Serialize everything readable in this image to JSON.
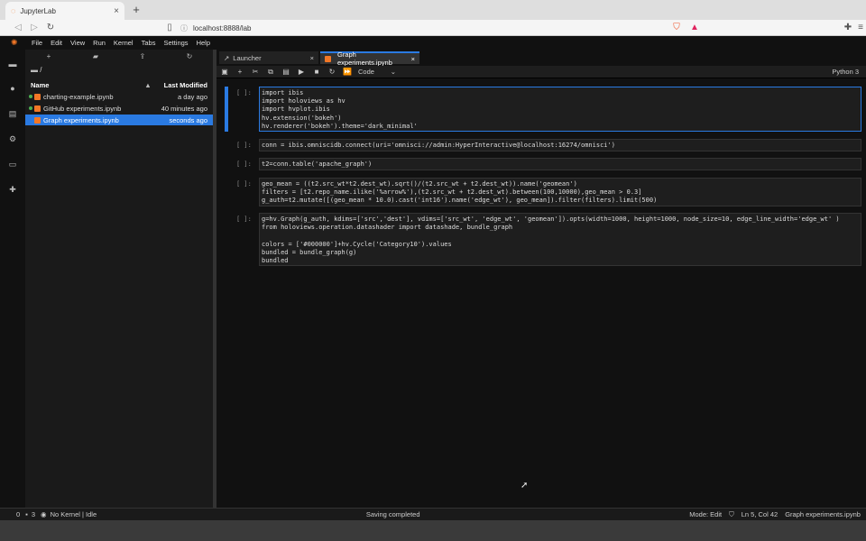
{
  "browser": {
    "tab_title": "JupyterLab",
    "tab_close": "×",
    "new_tab": "+",
    "back": "◁",
    "forward": "▷",
    "reload": "↻",
    "url": "localhost:8888/lab"
  },
  "menubar": {
    "items": [
      "File",
      "Edit",
      "View",
      "Run",
      "Kernel",
      "Tabs",
      "Settings",
      "Help"
    ]
  },
  "filebrowser": {
    "path": "/",
    "col_name": "Name",
    "col_modified": "Last Modified",
    "sort_indicator": "▲",
    "files": [
      {
        "name": "charting-example.ipynb",
        "modified": "a day ago",
        "running": true
      },
      {
        "name": "GitHub experiments.ipynb",
        "modified": "40 minutes ago",
        "running": true
      },
      {
        "name": "Graph experiments.ipynb",
        "modified": "seconds ago",
        "running": false
      }
    ]
  },
  "tabs": [
    {
      "label": "Launcher",
      "close": "×"
    },
    {
      "label": "Graph experiments.ipynb",
      "close": "×"
    }
  ],
  "toolbar": {
    "cell_type": "Code",
    "dropdown": "⌄",
    "kernel": "Python 3"
  },
  "cells": [
    {
      "prompt": "[ ]:",
      "code": "import ibis\nimport holoviews as hv\nimport hvplot.ibis\nhv.extension('bokeh')\nhv.renderer('bokeh').theme='dark_minimal'"
    },
    {
      "prompt": "[ ]:",
      "code": "conn = ibis.omniscidb.connect(uri='omnisci://admin:HyperInteractive@localhost:16274/omnisci')"
    },
    {
      "prompt": "[ ]:",
      "code": "t2=conn.table('apache_graph')"
    },
    {
      "prompt": "[ ]:",
      "code": "geo_mean = ((t2.src_wt*t2.dest_wt).sqrt()/(t2.src_wt + t2.dest_wt)).name('geomean')\nfilters = [t2.repo_name.ilike('%arrow%'),(t2.src_wt + t2.dest_wt).between(100,10000),geo_mean > 0.3]\ng_auth=t2.mutate([(geo_mean * 10.0).cast('int16').name('edge_wt'), geo_mean]).filter(filters).limit(500)"
    },
    {
      "prompt": "[ ]:",
      "code": "g=hv.Graph(g_auth, kdims=['src','dest'], vdims=['src_wt', 'edge_wt', 'geomean']).opts(width=1000, height=1000, node_size=10, edge_line_width='edge_wt' )\nfrom holoviews.operation.datashader import datashade, bundle_graph\n\ncolors = ['#000000']+hv.Cycle('Category10').values\nbundled = bundle_graph(g)\nbundled"
    }
  ],
  "status": {
    "zero": "0",
    "three": "3",
    "kernel": "No Kernel | Idle",
    "message": "Saving completed",
    "mode": "Mode: Edit",
    "position": "Ln 5, Col 42",
    "file": "Graph experiments.ipynb"
  },
  "colors": {
    "accent": "#2a7ae2",
    "jupyter_orange": "#f37726"
  }
}
